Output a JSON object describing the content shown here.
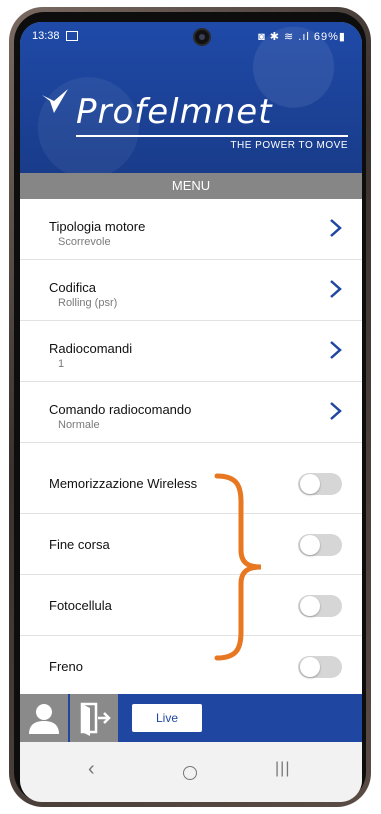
{
  "status": {
    "time": "13:38",
    "right": "◙ ✱ ≋ .ıl 69%▮"
  },
  "header": {
    "brand": "Profelmnet",
    "tagline": "THE POWER TO MOVE"
  },
  "menu_title": "MENU",
  "items": [
    {
      "label": "Tipologia motore",
      "value": "Scorrevole",
      "kind": "nav"
    },
    {
      "label": "Codifica",
      "value": "Rolling (psr)",
      "kind": "nav"
    },
    {
      "label": "Radiocomandi",
      "value": "1",
      "kind": "nav"
    },
    {
      "label": "Comando radiocomando",
      "value": "Normale",
      "kind": "nav"
    }
  ],
  "toggles": [
    {
      "label": "Memorizzazione Wireless",
      "on": false
    },
    {
      "label": "Fine corsa",
      "on": false
    },
    {
      "label": "Fotocellula",
      "on": false
    },
    {
      "label": "Freno",
      "on": false
    }
  ],
  "tabbar": {
    "live_label": "Live"
  },
  "navbar": {
    "back": "‹",
    "recent": "|||"
  },
  "colors": {
    "brand_blue": "#1f47a2",
    "annotation": "#e87722",
    "menu_gray": "#868686"
  },
  "icons": [
    "chevron-right-icon",
    "user-icon",
    "exit-icon",
    "camera-icon"
  ]
}
